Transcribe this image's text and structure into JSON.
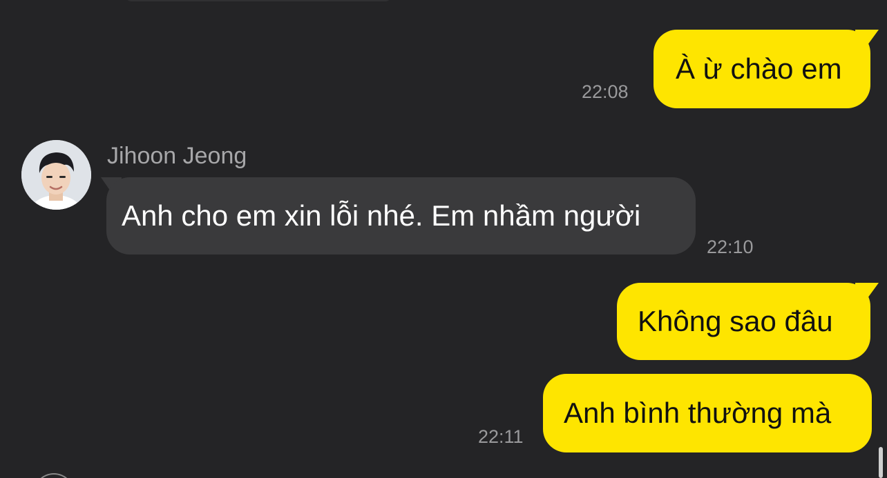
{
  "conversation": {
    "messages": [
      {
        "sender": "me",
        "text": "À ừ chào em",
        "time": "22:08"
      },
      {
        "sender": "Jihoon Jeong",
        "text": "Anh cho em xin lỗi nhé. Em nhầm người",
        "time": "22:10"
      },
      {
        "sender": "me",
        "text": "Không sao đâu",
        "time": ""
      },
      {
        "sender": "me",
        "text": "Anh bình thường mà",
        "time": "22:11"
      }
    ],
    "contact_name": "Jihoon Jeong"
  },
  "colors": {
    "background": "#242426",
    "outgoing_bubble": "#fee500",
    "incoming_bubble": "#3a3a3c",
    "timestamp": "#9a9a9c"
  },
  "icons": {
    "avatar": "profile-photo"
  }
}
